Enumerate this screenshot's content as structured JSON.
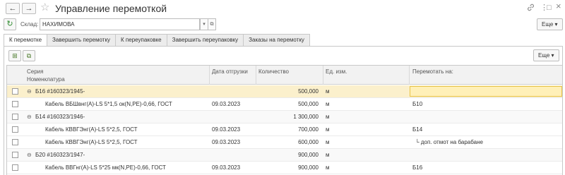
{
  "window": {
    "title": "Управление перемоткой",
    "back_icon": "←",
    "forward_icon": "→",
    "star_icon": "☆",
    "link_icon": "🔗",
    "menu_icon": "⋮",
    "maximize_icon": "□",
    "close_icon": "×"
  },
  "toolbar": {
    "refresh_icon": "↻",
    "warehouse_label": "Склад:",
    "warehouse_value": "НАХИМОВА",
    "dropdown_icon": "▾",
    "open_icon": "⧉",
    "more_label": "Еще ▾"
  },
  "tabs": [
    {
      "label": "К перемотке"
    },
    {
      "label": "Завершить перемотку"
    },
    {
      "label": "К переупаковке"
    },
    {
      "label": "Завершить переупаковку"
    },
    {
      "label": "Заказы на перемотку"
    }
  ],
  "panel": {
    "btn1_icon": "⊞",
    "btn2_icon": "⧉",
    "more_label": "Еще ▾"
  },
  "table": {
    "headers": {
      "series": "Серия",
      "nomenclature": "Номенклатура",
      "date": "Дата отгрузки",
      "qty": "Количество",
      "unit": "Ед. изм.",
      "rewind": "Перемотать на:"
    },
    "rows": [
      {
        "toggle": "⊖",
        "name": "Б16 #160323/1945-",
        "date": "",
        "qty": "500,000",
        "unit": "м",
        "rewind": ""
      },
      {
        "toggle": "",
        "name": "Кабель ВБШвнг(А)-LS 5*1,5 ок(N,PE)-0,66, ГОСТ",
        "date": "09.03.2023",
        "qty": "500,000",
        "unit": "м",
        "rewind": "Б10"
      },
      {
        "toggle": "⊖",
        "name": "Б14 #160323/1946-",
        "date": "",
        "qty": "1 300,000",
        "unit": "м",
        "rewind": ""
      },
      {
        "toggle": "",
        "name": "Кабель КВВГЭнг(А)-LS 5*2,5, ГОСТ",
        "date": "09.03.2023",
        "qty": "700,000",
        "unit": "м",
        "rewind": "Б14"
      },
      {
        "toggle": "",
        "name": "Кабель КВВГЭнг(А)-LS 5*2,5, ГОСТ",
        "date": "09.03.2023",
        "qty": "600,000",
        "unit": "м",
        "rewind": "└ доп. отмот на барабане"
      },
      {
        "toggle": "⊖",
        "name": "Б20 #160323/1947-",
        "date": "",
        "qty": "900,000",
        "unit": "м",
        "rewind": ""
      },
      {
        "toggle": "",
        "name": "Кабель ВВГнг(А)-LS 5*25 мк(N,PE)-0,66, ГОСТ",
        "date": "09.03.2023",
        "qty": "900,000",
        "unit": "м",
        "rewind": "Б16"
      }
    ]
  }
}
